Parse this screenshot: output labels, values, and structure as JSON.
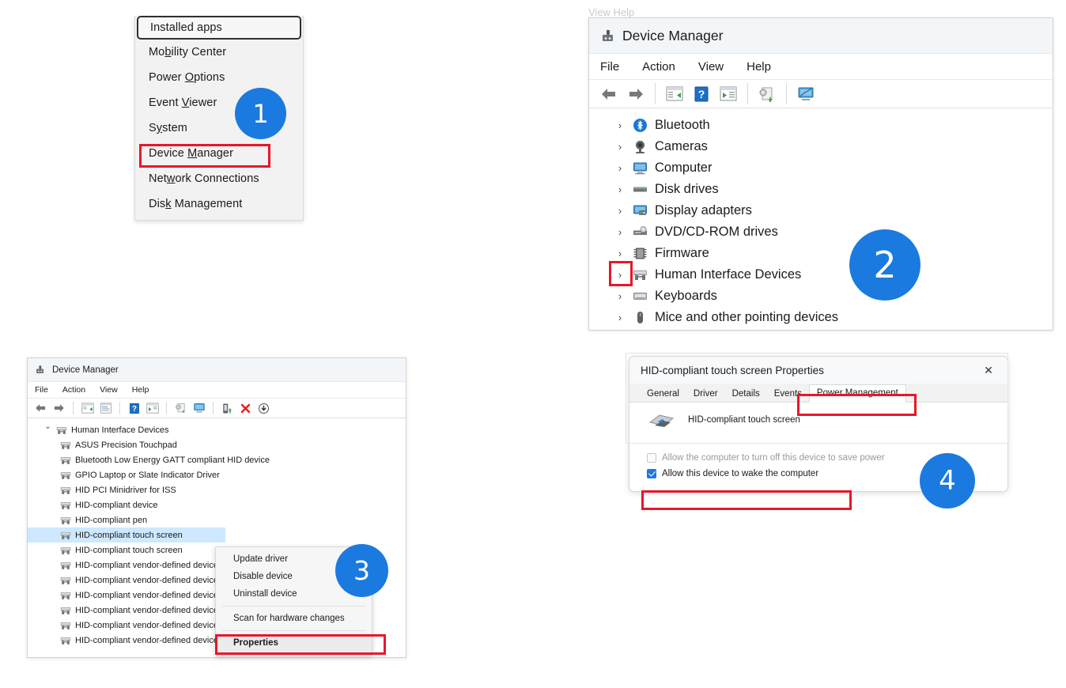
{
  "winx_menu": {
    "name": "Windows power user menu",
    "items": [
      {
        "label": "Installed apps",
        "pre": "Installed apps",
        "accel": "",
        "post": "",
        "focused": true
      },
      {
        "label": "Mobility Center",
        "pre": "Mo",
        "accel": "b",
        "post": "ility Center",
        "focused": false
      },
      {
        "label": "Power Options",
        "pre": "Power ",
        "accel": "O",
        "post": "ptions",
        "focused": false
      },
      {
        "label": "Event Viewer",
        "pre": "Event ",
        "accel": "V",
        "post": "iewer",
        "focused": false
      },
      {
        "label": "System",
        "pre": "S",
        "accel": "y",
        "post": "stem",
        "focused": false
      },
      {
        "label": "Device Manager",
        "pre": "Device ",
        "accel": "M",
        "post": "anager",
        "focused": false
      },
      {
        "label": "Network Connections",
        "pre": "Net",
        "accel": "w",
        "post": "ork Connections",
        "focused": false
      },
      {
        "label": "Disk Management",
        "pre": "Dis",
        "accel": "k",
        "post": " Management",
        "focused": false
      }
    ]
  },
  "step_badges": [
    {
      "number": "1"
    },
    {
      "number": "2"
    },
    {
      "number": "3"
    },
    {
      "number": "4"
    }
  ],
  "device_manager_2": {
    "title": "Device Manager",
    "menubar": [
      "File",
      "Action",
      "View",
      "Help"
    ],
    "toolbar_icons": [
      "back-arrow-icon",
      "forward-arrow-icon",
      "show-hide-console-tree-icon",
      "help-icon",
      "show-action-pane-icon",
      "scan-for-hardware-changes-icon",
      "display-device-icon"
    ],
    "tree": [
      {
        "label": "Bluetooth",
        "icon": "bluetooth-icon"
      },
      {
        "label": "Cameras",
        "icon": "camera-icon"
      },
      {
        "label": "Computer",
        "icon": "computer-icon"
      },
      {
        "label": "Disk drives",
        "icon": "disk-drive-icon"
      },
      {
        "label": "Display adapters",
        "icon": "display-adapter-icon"
      },
      {
        "label": "DVD/CD-ROM drives",
        "icon": "dvd-drive-icon"
      },
      {
        "label": "Firmware",
        "icon": "firmware-icon"
      },
      {
        "label": "Human Interface Devices",
        "icon": "hid-icon"
      },
      {
        "label": "Keyboards",
        "icon": "keyboard-icon"
      },
      {
        "label": "Mice and other pointing devices",
        "icon": "mouse-icon"
      }
    ],
    "chevron_collapsed": "›",
    "partial_top_row": "View            Help"
  },
  "device_manager_3": {
    "title": "Device Manager",
    "menubar": [
      "File",
      "Action",
      "View",
      "Help"
    ],
    "toolbar_icons": [
      "back-arrow-icon",
      "forward-arrow-icon",
      "show-hide-console-tree-icon",
      "properties-icon",
      "help-icon",
      "show-action-pane-icon",
      "scan-for-hardware-changes-icon",
      "display-device-icon",
      "update-driver-icon",
      "uninstall-device-icon",
      "disable-device-icon"
    ],
    "chevron_expanded": "⌄",
    "chevron_collapsed": "›",
    "root": {
      "label": "Human Interface Devices",
      "icon": "hid-icon"
    },
    "children": [
      {
        "label": "ASUS Precision Touchpad",
        "selected": false
      },
      {
        "label": "Bluetooth Low Energy GATT compliant HID device",
        "selected": false
      },
      {
        "label": "GPIO Laptop or Slate Indicator Driver",
        "selected": false
      },
      {
        "label": "HID PCI Minidriver for ISS",
        "selected": false
      },
      {
        "label": "HID-compliant device",
        "selected": false
      },
      {
        "label": "HID-compliant pen",
        "selected": false
      },
      {
        "label": "HID-compliant touch screen",
        "selected": true
      },
      {
        "label": "HID-compliant touch screen",
        "selected": false
      },
      {
        "label": "HID-compliant vendor-defined device",
        "selected": false
      },
      {
        "label": "HID-compliant vendor-defined device",
        "selected": false
      },
      {
        "label": "HID-compliant vendor-defined device",
        "selected": false
      },
      {
        "label": "HID-compliant vendor-defined device",
        "selected": false
      },
      {
        "label": "HID-compliant vendor-defined device",
        "selected": false
      },
      {
        "label": "HID-compliant vendor-defined device",
        "selected": false
      }
    ]
  },
  "context_menu": {
    "items": [
      {
        "label": "Update driver",
        "bold": false,
        "separator_after": false
      },
      {
        "label": "Disable device",
        "bold": false,
        "separator_after": false
      },
      {
        "label": "Uninstall device",
        "bold": false,
        "separator_after": true
      },
      {
        "label": "Scan for hardware changes",
        "bold": false,
        "separator_after": true
      },
      {
        "label": "Properties",
        "bold": true,
        "separator_after": false
      }
    ]
  },
  "properties_dialog": {
    "title": "HID-compliant touch screen Properties",
    "close_label": "✕",
    "tabs": [
      {
        "label": "General",
        "active": false
      },
      {
        "label": "Driver",
        "active": false
      },
      {
        "label": "Details",
        "active": false
      },
      {
        "label": "Events",
        "active": false
      },
      {
        "label": "Power Management",
        "active": true
      }
    ],
    "device_name": "HID-compliant touch screen",
    "device_icon": "touch-screen-device-icon",
    "checkboxes": [
      {
        "label": "Allow the computer to turn off this device to save power",
        "checked": false,
        "disabled": true
      },
      {
        "label": "Allow this device to wake the computer",
        "checked": true,
        "disabled": false
      }
    ]
  },
  "colors": {
    "badge_blue": "#1a7ae0",
    "highlight_red": "#e8172a",
    "selection_blue": "#cde8ff",
    "titlebar": "#f3f6f9"
  }
}
